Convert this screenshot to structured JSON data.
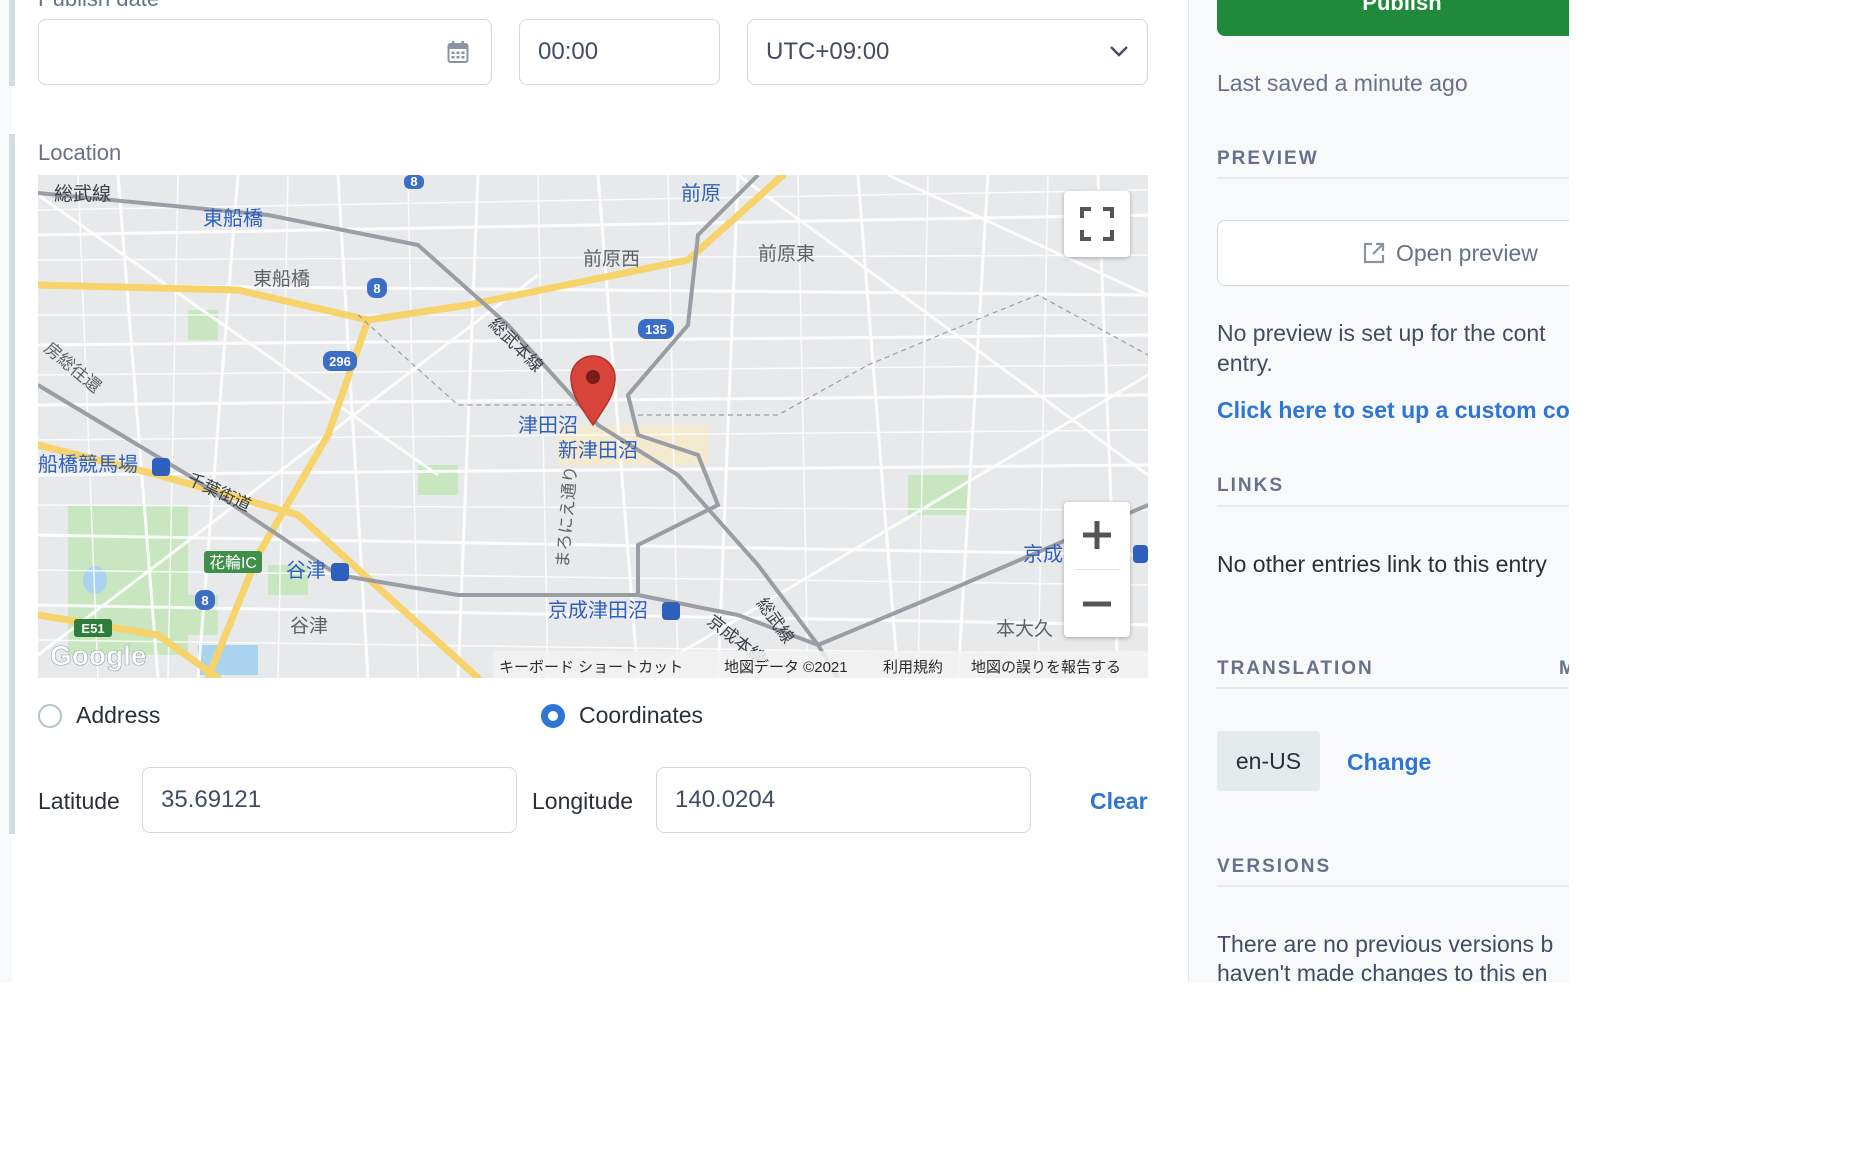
{
  "publish": {
    "label": "Publish date",
    "date_value": "",
    "time_value": "00:00",
    "timezone": "UTC+09:00"
  },
  "location": {
    "label": "Location",
    "map": {
      "stations": [
        "総武線",
        "東船橋",
        "前原",
        "前原西",
        "前原東",
        "総武本線",
        "津田沼",
        "新津田沼",
        "船橋競馬場",
        "千葉街道",
        "花輪IC",
        "谷津",
        "京成津田沼",
        "京成本線",
        "京成",
        "本大久",
        "房総往還",
        "まろにえ通り",
        "東船橋",
        "谷津"
      ],
      "route_shields": [
        "8",
        "8",
        "135",
        "296",
        "8",
        "E51"
      ],
      "footer": {
        "shortcuts": "キーボード ショートカット",
        "copyright": "地図データ ©2021",
        "terms": "利用規約",
        "report": "地図の誤りを報告する"
      },
      "logo": "Google"
    },
    "mode_options": {
      "address": "Address",
      "coordinates": "Coordinates",
      "selected": "coordinates"
    },
    "latitude_label": "Latitude",
    "latitude_value": "35.69121",
    "longitude_label": "Longitude",
    "longitude_value": "140.0204",
    "clear_label": "Clear"
  },
  "sidebar": {
    "publish_button": "Publish",
    "last_saved": "Last saved a minute ago",
    "preview": {
      "title": "PREVIEW",
      "open_preview": "Open preview",
      "message_line1": "No preview is set up for the cont",
      "message_line2": "entry.",
      "link": "Click here to set up a custom co"
    },
    "links": {
      "title": "LINKS",
      "message": "No other entries link to this entry"
    },
    "translation": {
      "title": "TRANSLATION",
      "trailing": "M",
      "locale": "en-US",
      "change": "Change"
    },
    "versions": {
      "title": "VERSIONS",
      "line1": "There are no previous versions b",
      "line2": "haven't made changes to this en"
    }
  },
  "colors": {
    "accent_blue": "#2e75d4",
    "publish_green": "#1f8a3b",
    "map_pin": "#d9443a"
  }
}
